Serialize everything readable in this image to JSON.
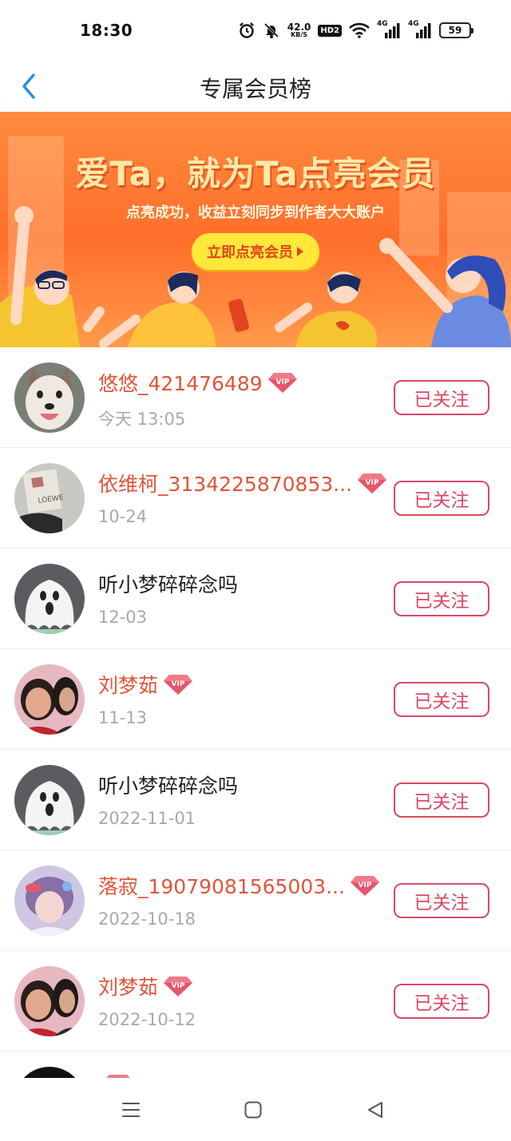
{
  "status_bar": {
    "time": "18:30",
    "net_speed_value": "42.0",
    "net_speed_unit": "KB/S",
    "hd_label": "HD2",
    "signal_1_label": "4G",
    "signal_2_label": "4G",
    "battery_level": "59",
    "icons": [
      "alarm-icon",
      "mute-icon",
      "wifi-icon",
      "signal-icon",
      "battery-icon"
    ]
  },
  "header": {
    "title": "专属会员榜",
    "back_icon": "back-chevron-icon",
    "accent_color": "#1e90e6"
  },
  "banner": {
    "headline": "爱Ta，就为Ta点亮会员",
    "subtitle": "点亮成功，收益立刻同步到作者大大账户",
    "cta_label": "立即点亮会员",
    "cta_icon": "play-triangle-icon"
  },
  "members": [
    {
      "name": "悠悠_421476489",
      "vip": true,
      "date": "今天 13:05",
      "follow_label": "已关注",
      "avatar": "husky-dog"
    },
    {
      "name": "依维柯_3134225870853...",
      "vip": true,
      "date": "10-24",
      "follow_label": "已关注",
      "avatar": "paper-bag"
    },
    {
      "name": "听小梦碎碎念吗",
      "vip": false,
      "date": "12-03",
      "follow_label": "已关注",
      "avatar": "ghost"
    },
    {
      "name": "刘梦茹",
      "vip": true,
      "date": "11-13",
      "follow_label": "已关注",
      "avatar": "two-girls"
    },
    {
      "name": "听小梦碎碎念吗",
      "vip": false,
      "date": "2022-11-01",
      "follow_label": "已关注",
      "avatar": "ghost"
    },
    {
      "name": "落寂_19079081565003...",
      "vip": true,
      "date": "2022-10-18",
      "follow_label": "已关注",
      "avatar": "anime-girl"
    },
    {
      "name": "刘梦茹",
      "vip": true,
      "date": "2022-10-12",
      "follow_label": "已关注",
      "avatar": "two-girls"
    },
    {
      "name": "",
      "vip": true,
      "date": "",
      "follow_label": "",
      "avatar": "dark"
    }
  ],
  "vip_badge_text": "VIP",
  "colors": {
    "vip_name": "#e0553a",
    "follow_border": "#d94963",
    "date_gray": "#a8a8a8",
    "banner_orange": "#ff6f2c",
    "cta_yellow": "#ffe83a"
  },
  "nav_bar": {
    "items": [
      "menu-icon",
      "home-square-icon",
      "back-triangle-icon"
    ]
  }
}
